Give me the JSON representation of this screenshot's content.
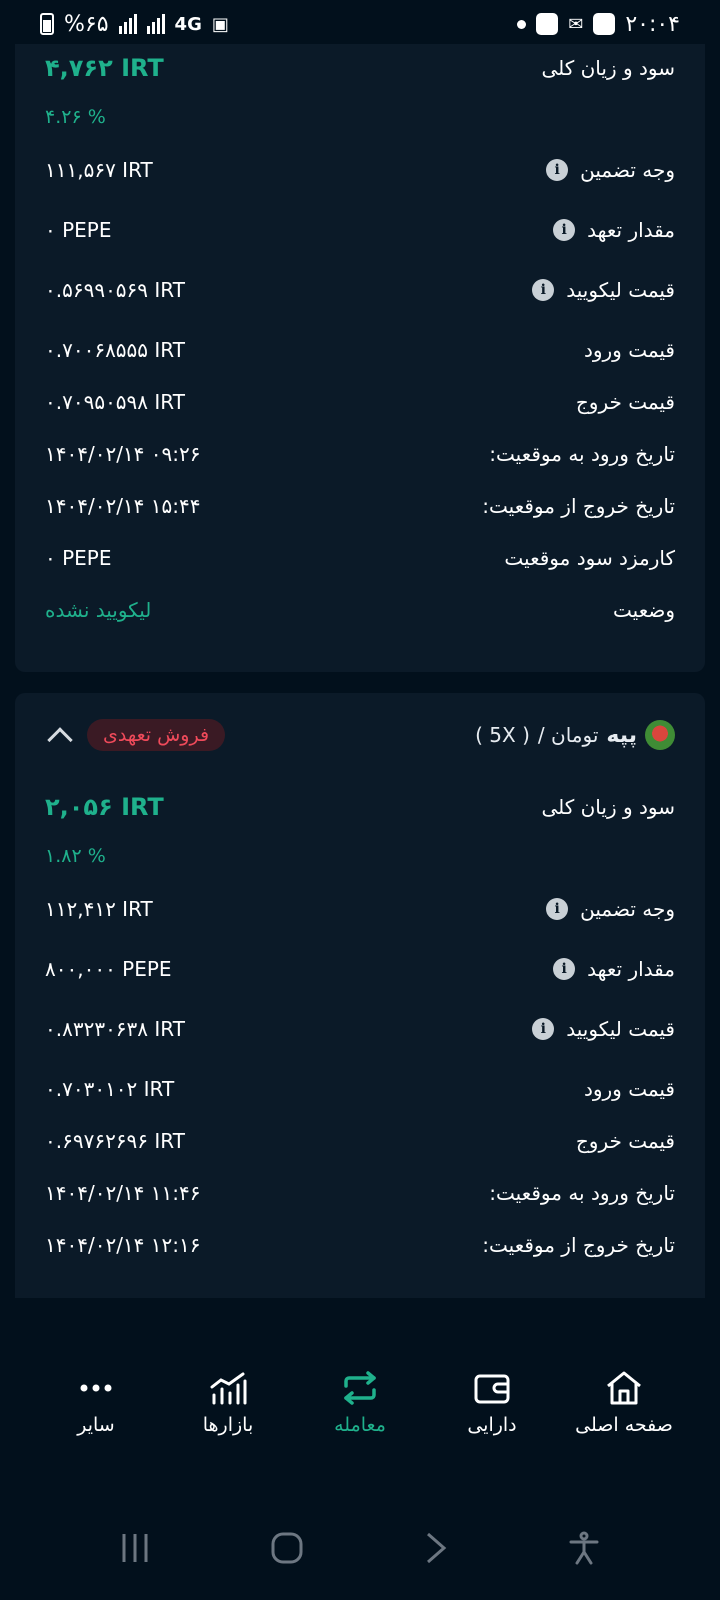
{
  "status_bar": {
    "time": "۲۰:۰۴",
    "battery": "%۶۵",
    "network": "4G"
  },
  "position1": {
    "pnl_label": "سود و زیان کلی",
    "pnl_value": "۴,۷۶۲ IRT",
    "pnl_percent": "۴.۲۶ %",
    "rows": [
      {
        "label": "وجه تضمین",
        "value": "۱۱۱,۵۶۷ IRT"
      },
      {
        "label": "مقدار تعهد",
        "value": "۰ PEPE"
      },
      {
        "label": "قیمت لیکویید",
        "value": "۰.۵۶۹۹۰۵۶۹ IRT"
      },
      {
        "label": "قیمت ورود",
        "value": "۰.۷۰۰۶۸۵۵۵ IRT"
      },
      {
        "label": "قیمت خروج",
        "value": "۰.۷۰۹۵۰۵۹۸ IRT"
      },
      {
        "label": "تاریخ ورود به موقعیت:",
        "value": "۱۴۰۴/۰۲/۱۴ ۰۹:۲۶"
      },
      {
        "label": "تاریخ خروج از موقعیت:",
        "value": "۱۴۰۴/۰۲/۱۴ ۱۵:۴۴"
      },
      {
        "label": "کارمزد سود موقعیت",
        "value": "۰ PEPE"
      },
      {
        "label": "وضعیت",
        "value": "لیکویید نشده"
      }
    ]
  },
  "position2": {
    "coin": "پپه",
    "quote": "/ تومان",
    "leverage": "( 5X )",
    "badge": "فروش تعهدی",
    "pnl_label": "سود و زیان کلی",
    "pnl_value": "۲,۰۵۶ IRT",
    "pnl_percent": "۱.۸۲ %",
    "rows": [
      {
        "label": "وجه تضمین",
        "value": "۱۱۲,۴۱۲ IRT"
      },
      {
        "label": "مقدار تعهد",
        "value": "۸۰۰,۰۰۰ PEPE"
      },
      {
        "label": "قیمت لیکویید",
        "value": "۰.۸۳۲۳۰۶۳۸ IRT"
      },
      {
        "label": "قیمت ورود",
        "value": "۰.۷۰۳۰۱۰۲ IRT"
      },
      {
        "label": "قیمت خروج",
        "value": "۰.۶۹۷۶۲۶۹۶ IRT"
      },
      {
        "label": "تاریخ ورود به موقعیت:",
        "value": "۱۴۰۴/۰۲/۱۴ ۱۱:۴۶"
      },
      {
        "label": "تاریخ خروج از موقعیت:",
        "value": "۱۴۰۴/۰۲/۱۴ ۱۲:۱۶"
      }
    ]
  },
  "nav": {
    "more": "سایر",
    "markets": "بازارها",
    "trade": "معامله",
    "assets": "دارایی",
    "home": "صفحه اصلی"
  },
  "colors": {
    "accent": "#1fb18c",
    "sell": "#ef4a5a",
    "card": "#0b1a28",
    "background": "#02101c"
  }
}
